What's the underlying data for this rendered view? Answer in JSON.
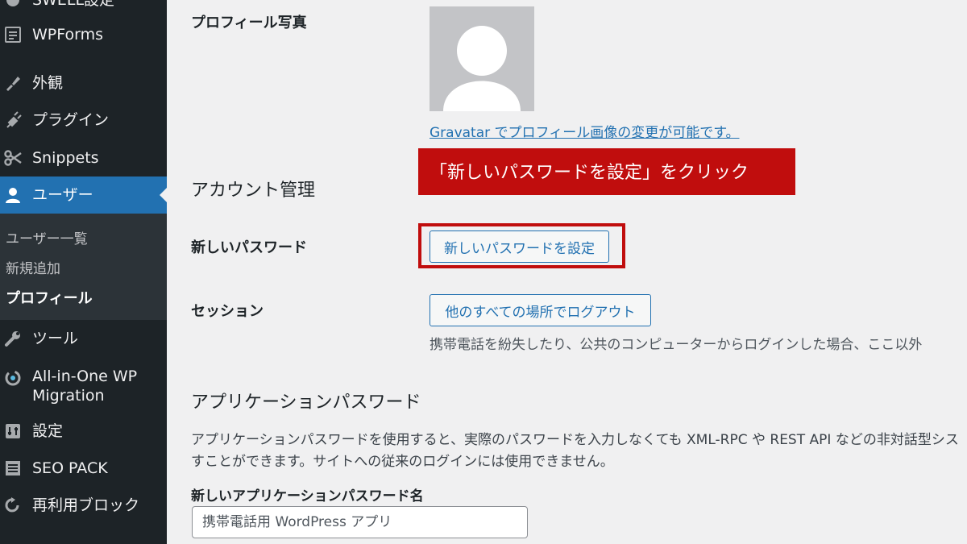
{
  "sidebar": {
    "items": [
      {
        "label": "SWELL設定",
        "icon": "swell-icon"
      },
      {
        "label": "WPForms",
        "icon": "wpforms-icon"
      },
      {
        "label": "外観",
        "icon": "appearance-icon"
      },
      {
        "label": "プラグイン",
        "icon": "plugins-icon"
      },
      {
        "label": "Snippets",
        "icon": "snippets-icon"
      },
      {
        "label": "ユーザー",
        "icon": "users-icon",
        "active": true
      },
      {
        "label": "ツール",
        "icon": "tools-icon"
      },
      {
        "label": "All-in-One WP",
        "label2": "Migration",
        "icon": "migration-icon"
      },
      {
        "label": "設定",
        "icon": "settings-icon"
      },
      {
        "label": "SEO PACK",
        "icon": "seo-pack-icon"
      },
      {
        "label": "再利用ブロック",
        "icon": "reusable-blocks-icon"
      }
    ],
    "submenu": [
      {
        "label": "ユーザー一覧"
      },
      {
        "label": "新規追加"
      },
      {
        "label": "プロフィール",
        "current": true
      }
    ]
  },
  "profile": {
    "photo_label": "プロフィール写真",
    "gravatar_link": "Gravatar でプロフィール画像の変更が可能です。"
  },
  "callout": "「新しいパスワードを設定」をクリック",
  "account": {
    "title": "アカウント管理",
    "new_password_label": "新しいパスワード",
    "new_password_button": "新しいパスワードを設定",
    "sessions_label": "セッション",
    "logout_button": "他のすべての場所でログアウト",
    "sessions_desc": "携帯電話を紛失したり、公共のコンピューターからログインした場合、ここ以外"
  },
  "app_passwords": {
    "title": "アプリケーションパスワード",
    "desc_line1": "アプリケーションパスワードを使用すると、実際のパスワードを入力しなくても XML-RPC や REST API などの非対話型シス",
    "desc_line2": "すことができます。サイトへの従来のログインには使用できません。",
    "name_label": "新しいアプリケーションパスワード名",
    "name_placeholder": "携帯電話用 WordPress アプリ"
  },
  "colors": {
    "sidebar_bg": "#1d2327",
    "active_bg": "#2271b1",
    "callout_red": "#c00d0d",
    "link_blue": "#2271b1"
  }
}
